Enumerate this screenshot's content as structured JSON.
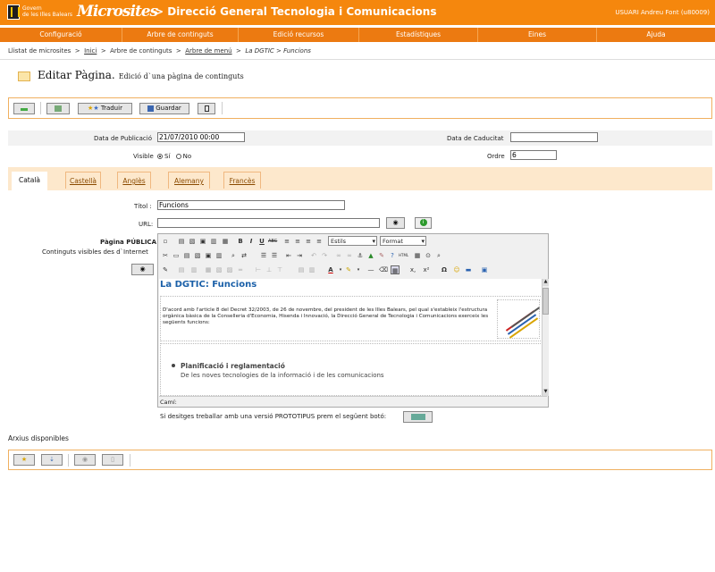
{
  "header": {
    "gov_line1": "Govern",
    "gov_line2": "de les Illes Balears",
    "brand": "Microsites",
    "title": "> Direcció General Tecnologia i Comunicacions",
    "user": "USUARI Andreu Font (u80009)"
  },
  "menu": [
    "Configuració",
    "Arbre de continguts",
    "Edició recursos",
    "Estadístiques",
    "Eines",
    "Ajuda"
  ],
  "breadcrumb": {
    "b1": "Llistat de microsites",
    "sep": ">",
    "b2": "Inici",
    "b3": "Arbre de continguts",
    "b4": "Arbre de menú",
    "b5": "La DGTIC > Funcions"
  },
  "page": {
    "title": "Editar Pàgina.",
    "subtitle": "Edició d`una pàgina de continguts"
  },
  "toolbar": {
    "translate": "Traduir",
    "save": "Guardar"
  },
  "form": {
    "pub_label": "Data de Publicació",
    "pub_value": "21/07/2010 00:00",
    "cad_label": "Data de Caducitat",
    "cad_value": "",
    "visible_label": "Visible",
    "yes": "Sí",
    "no": "No",
    "ordre_label": "Ordre",
    "ordre_value": "6"
  },
  "tabs": [
    "Català",
    "Castellà",
    "Anglès",
    "Alemany",
    "Francès"
  ],
  "content": {
    "title_label": "Títol :",
    "title_value": "Funcions",
    "url_label": "URL:",
    "url_value": "",
    "public_label": "Pàgina PÚBLICA",
    "public_sub": "Continguts visibles des d`Internet"
  },
  "editor": {
    "styles": "Estils",
    "format": "Format",
    "heading": "La DGTIC: Funcions",
    "paragraph": "D'acord amb l'article 8 del Decret 32/2003, de 26 de novembre, del president de les Illes Balears, pel qual s'estableix l'estructura orgànica bàsica de la Conselleria d'Economia, Hisenda i Innovació, la Direcció General de Tecnologia i Comunicacions exerceix les següents funcions:",
    "bullet_title": "Planificació i reglamentació",
    "bullet_text": "De les noves tecnologies de la informació i de les comunicacions",
    "path": "Camí:"
  },
  "prototipus": "Si desitges treballar amb una versió PROTOTIPUS prem el següent botó:",
  "files_label": "Arxius disponibles"
}
